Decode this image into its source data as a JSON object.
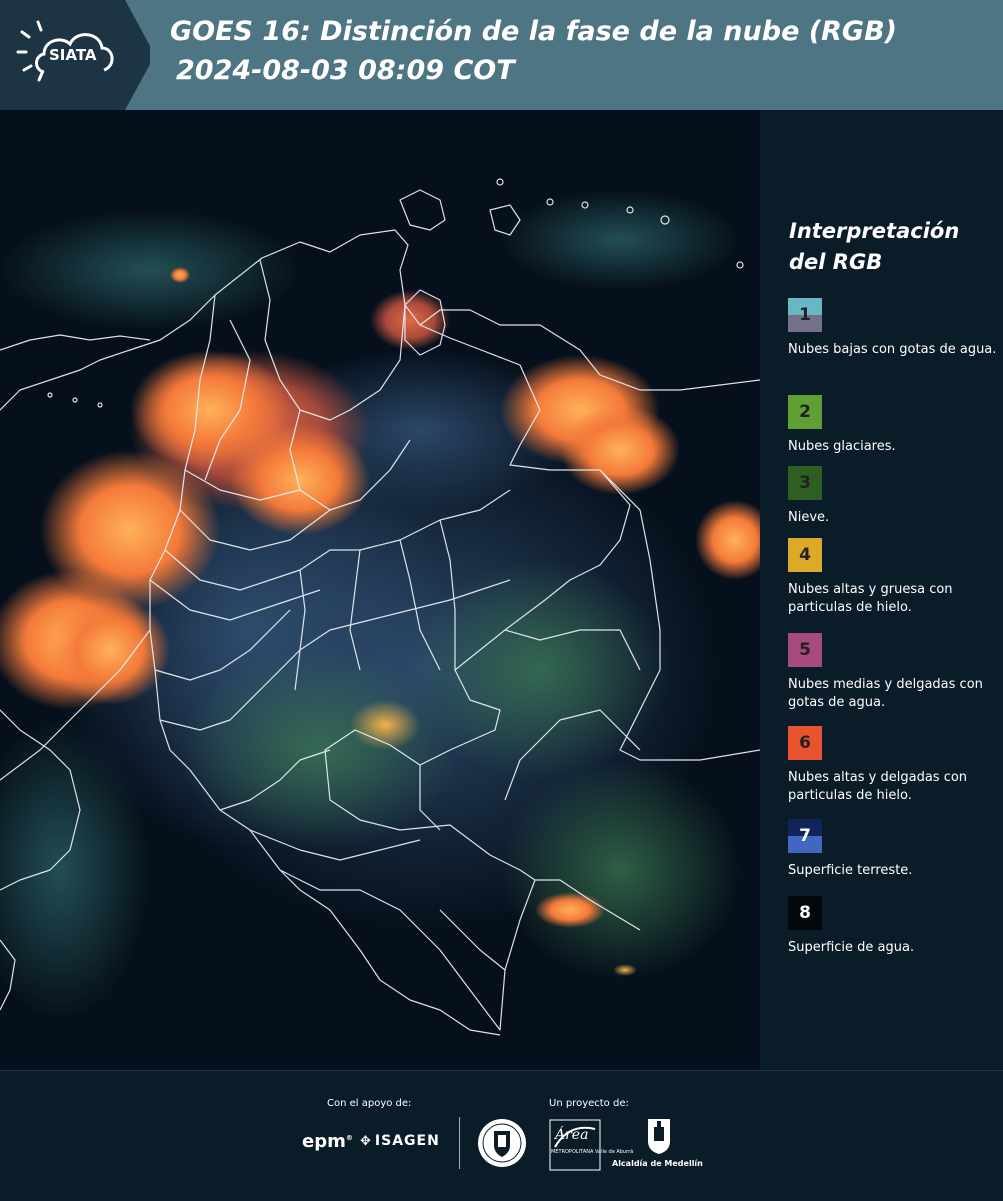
{
  "header": {
    "logo_text": "SIATA",
    "title_line1": "GOES 16: Distinción de la fase de la nube (RGB)",
    "title_line2": "2024-08-03 08:09 COT",
    "background_color": "#4d7584"
  },
  "legend": {
    "title": "Interpretación del RGB",
    "items": [
      {
        "number": "1",
        "label": "Nubes bajas con gotas de agua.",
        "color_top": "#67b7c4",
        "color_bottom": "#75718a"
      },
      {
        "number": "2",
        "label": "Nubes glaciares.",
        "color_top": "#5f9f33",
        "color_bottom": "#5f9f33"
      },
      {
        "number": "3",
        "label": "Nieve.",
        "color_top": "#2e5e22",
        "color_bottom": "#2e5e22"
      },
      {
        "number": "4",
        "label": "Nubes altas y gruesa con particulas de hielo.",
        "color_top": "#ddaa27",
        "color_bottom": "#ddaa27"
      },
      {
        "number": "5",
        "label": "Nubes medias y delgadas con gotas de agua.",
        "color_top": "#a54b7d",
        "color_bottom": "#a54b7d"
      },
      {
        "number": "6",
        "label": "Nubes altas y delgadas con particulas de hielo.",
        "color_top": "#e9532f",
        "color_bottom": "#e9532f"
      },
      {
        "number": "7",
        "label": "Superficie terreste.",
        "color_top": "#10235a",
        "color_bottom": "#4167c1"
      },
      {
        "number": "8",
        "label": "Superficie de agua.",
        "color_top": "#02080a",
        "color_bottom": "#02080a"
      }
    ]
  },
  "footer": {
    "support_label": "Con el apoyo de:",
    "project_label": "Un proyecto de:",
    "sponsor_1": "epm",
    "sponsor_2": "ISAGEN",
    "partner_area": "Área",
    "partner_area_sub": "METROPOLITANA Valle de Aburrá",
    "partner_alcaldia": "Alcaldía de Medellín"
  }
}
